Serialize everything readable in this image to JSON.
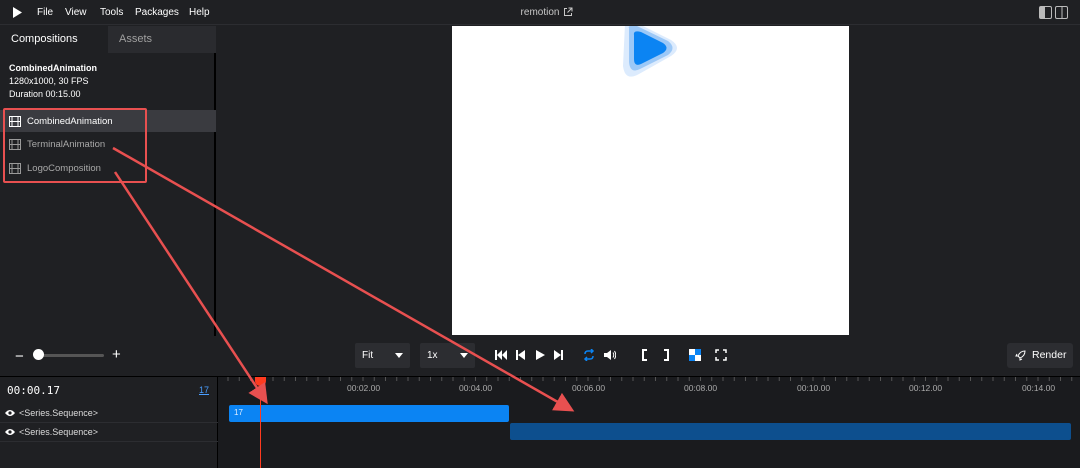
{
  "menu": {
    "items": [
      "File",
      "View",
      "Tools",
      "Packages",
      "Help"
    ],
    "title": "remotion"
  },
  "tabs": {
    "compositions": "Compositions",
    "assets": "Assets"
  },
  "info": {
    "name": "CombinedAnimation",
    "size_fps": "1280x1000, 30 FPS",
    "duration": "Duration 00:15.00"
  },
  "compositions": [
    {
      "label": "CombinedAnimation",
      "selected": true
    },
    {
      "label": "TerminalAnimation",
      "selected": false
    },
    {
      "label": "LogoComposition",
      "selected": false
    }
  ],
  "controls": {
    "fit": "Fit",
    "speed": "1x",
    "render": "Render",
    "zoom_minus": "−",
    "zoom_plus": "+"
  },
  "timeline": {
    "timecode": "00:00.17",
    "frame": "17",
    "ticks": [
      "00:02.00",
      "00:04.00",
      "00:06.00",
      "00:08.00",
      "00:10.00",
      "00:12.00",
      "00:14.00"
    ],
    "tracks": [
      "<Series.Sequence>",
      "<Series.Sequence>"
    ],
    "seq_a_label": "17"
  },
  "colors": {
    "accent": "#0b84f3",
    "seq_dark": "#0d4f8e",
    "playhead": "#ff3b1f",
    "annotation": "#e85050"
  }
}
